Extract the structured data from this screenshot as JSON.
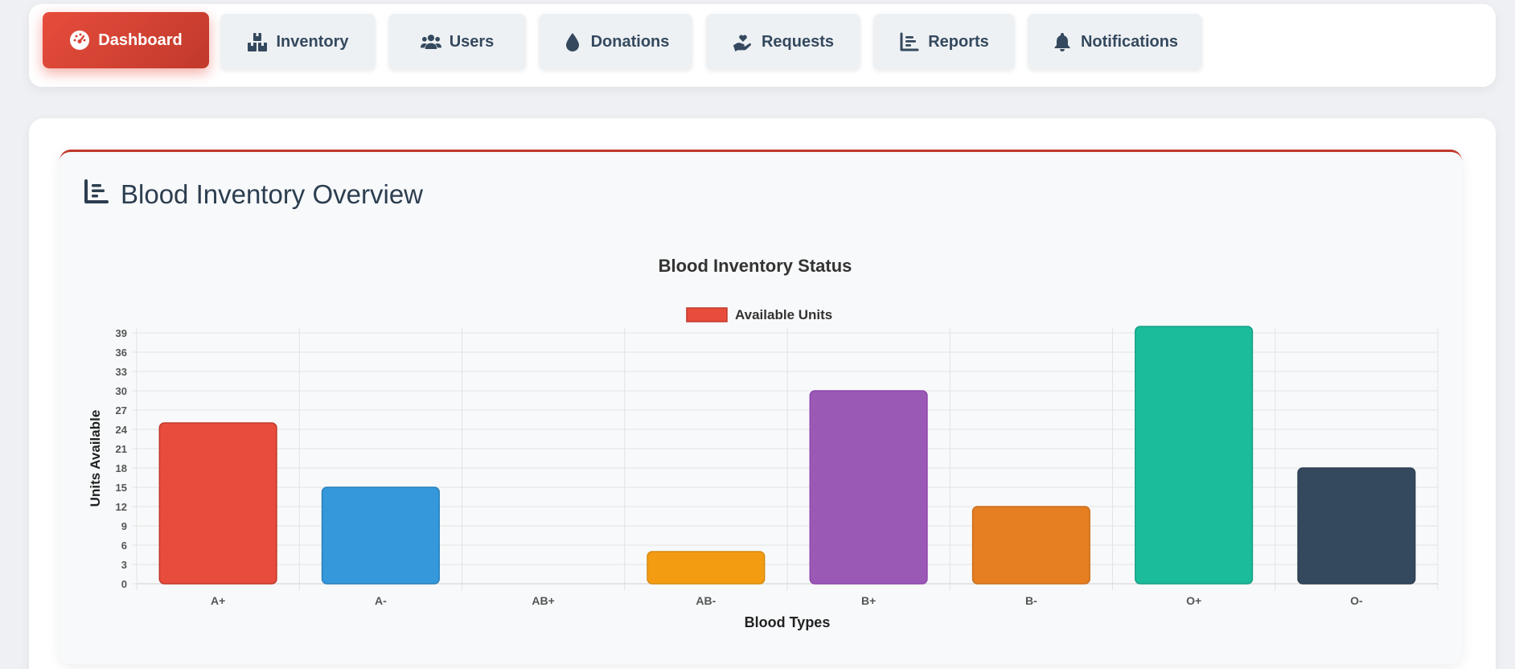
{
  "nav": {
    "items": [
      {
        "label": "Dashboard",
        "icon": "gauge-icon",
        "active": true
      },
      {
        "label": "Inventory",
        "icon": "boxes-icon",
        "active": false
      },
      {
        "label": "Users",
        "icon": "users-icon",
        "active": false
      },
      {
        "label": "Donations",
        "icon": "droplet-icon",
        "active": false
      },
      {
        "label": "Requests",
        "icon": "hand-holding-heart-icon",
        "active": false
      },
      {
        "label": "Reports",
        "icon": "bar-chart-icon",
        "active": false
      },
      {
        "label": "Notifications",
        "icon": "bell-icon",
        "active": false
      }
    ]
  },
  "panel": {
    "title": "Blood Inventory Overview",
    "icon": "bar-chart-icon"
  },
  "colors": {
    "accent": "#e74c3c",
    "accent_dark": "#c0392b"
  },
  "chart_data": {
    "type": "bar",
    "title": "Blood Inventory Status",
    "xlabel": "Blood Types",
    "ylabel": "Units Available",
    "ylim": [
      0,
      39
    ],
    "yticks": [
      0,
      3,
      6,
      9,
      12,
      15,
      18,
      21,
      24,
      27,
      30,
      33,
      36,
      39
    ],
    "grid": true,
    "legend_position": "top",
    "categories": [
      "A+",
      "A-",
      "AB+",
      "AB-",
      "B+",
      "B-",
      "O+",
      "O-"
    ],
    "series": [
      {
        "name": "Available Units",
        "values": [
          25,
          15,
          0,
          5,
          30,
          12,
          40,
          18
        ],
        "colors": [
          "#e74c3c",
          "#3498db",
          "#95a5a6",
          "#f39c12",
          "#9b59b6",
          "#e67e22",
          "#1abc9c",
          "#34495e"
        ]
      }
    ]
  }
}
